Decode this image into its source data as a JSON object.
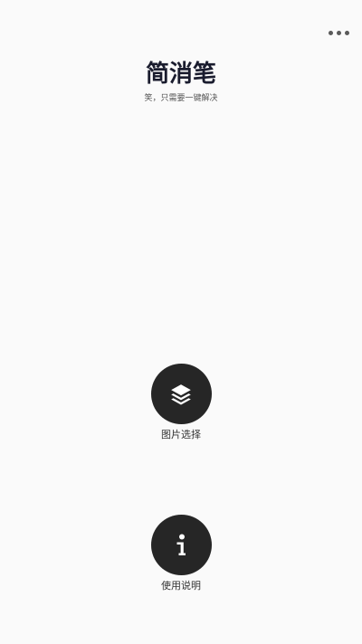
{
  "header": {
    "more_icon": "more-horizontal-icon"
  },
  "app": {
    "title": "简消笔",
    "subtitle": "笑，只需要一键解决"
  },
  "actions": [
    {
      "icon": "layers-icon",
      "label": "图片选择"
    },
    {
      "icon": "info-icon",
      "label": "使用说明"
    }
  ],
  "colors": {
    "background": "#fafafa",
    "button": "#262626",
    "title": "#1a1c2e"
  }
}
